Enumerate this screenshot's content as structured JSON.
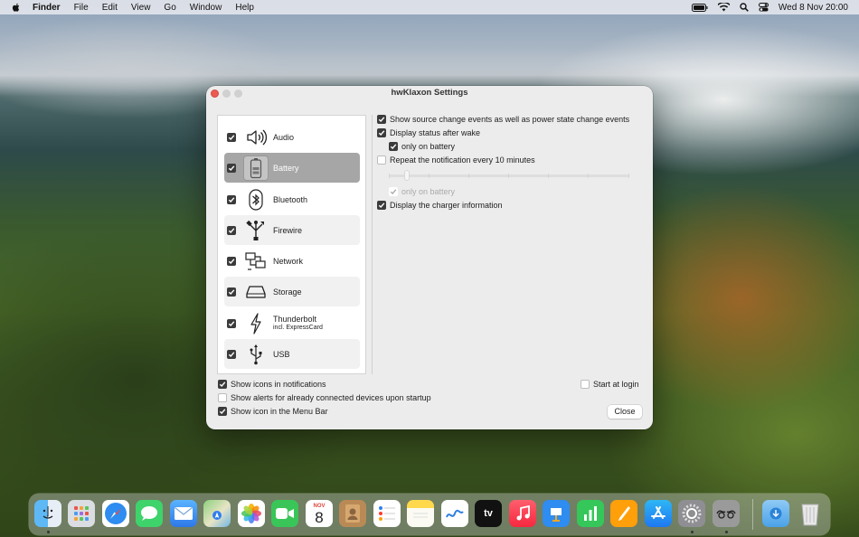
{
  "menubar": {
    "app": "Finder",
    "items": [
      "File",
      "Edit",
      "View",
      "Go",
      "Window",
      "Help"
    ],
    "datetime": "Wed 8 Nov  20:00"
  },
  "window": {
    "title": "hwKlaxon Settings"
  },
  "devices": [
    {
      "label": "Audio",
      "sub": "",
      "checked": true,
      "icon": "speaker-icon"
    },
    {
      "label": "Battery",
      "sub": "",
      "checked": true,
      "icon": "battery-icon"
    },
    {
      "label": "Bluetooth",
      "sub": "",
      "checked": true,
      "icon": "bluetooth-icon"
    },
    {
      "label": "Firewire",
      "sub": "",
      "checked": true,
      "icon": "firewire-icon"
    },
    {
      "label": "Network",
      "sub": "",
      "checked": true,
      "icon": "network-icon"
    },
    {
      "label": "Storage",
      "sub": "",
      "checked": true,
      "icon": "drive-icon"
    },
    {
      "label": "Thunderbolt",
      "sub": "incl. ExpressCard",
      "checked": true,
      "icon": "thunderbolt-icon"
    },
    {
      "label": "USB",
      "sub": "",
      "checked": true,
      "icon": "usb-icon"
    }
  ],
  "selected_device": "Battery",
  "options": {
    "source_change": {
      "label": "Show source change events as well as power state change events",
      "checked": true
    },
    "status_after_wake": {
      "label": "Display status after wake",
      "checked": true
    },
    "wake_only_battery": {
      "label": "only on battery",
      "checked": true
    },
    "repeat_notification": {
      "label": "Repeat the notification every 10 minutes",
      "checked": false
    },
    "repeat_only_battery": {
      "label": "only on battery",
      "checked": true,
      "disabled": true
    },
    "charger_info": {
      "label": "Display the charger information",
      "checked": true
    }
  },
  "bottom": {
    "show_icons": {
      "label": "Show icons in notifications",
      "checked": true
    },
    "show_alerts": {
      "label": "Show alerts for already connected devices upon startup",
      "checked": false
    },
    "menubar_icon": {
      "label": "Show icon in the Menu Bar",
      "checked": true
    },
    "start_login": {
      "label": "Start at login",
      "checked": false
    },
    "close_label": "Close"
  },
  "dock": {
    "calendar_month": "NOV",
    "calendar_day": "8",
    "tv_label": "tv",
    "apps": [
      "finder-icon",
      "launchpad-icon",
      "safari-icon",
      "messages-icon",
      "mail-icon",
      "maps-icon",
      "photos-icon",
      "facetime-icon",
      "calendar-icon",
      "contacts-icon",
      "reminders-icon",
      "notes-icon",
      "freeform-icon",
      "appletv-icon",
      "music-icon",
      "keynote-icon",
      "numbers-icon",
      "pages-icon",
      "appstore-icon",
      "settings-icon",
      "hwklaxon-icon",
      "downloads-folder-icon",
      "trash-icon"
    ]
  }
}
